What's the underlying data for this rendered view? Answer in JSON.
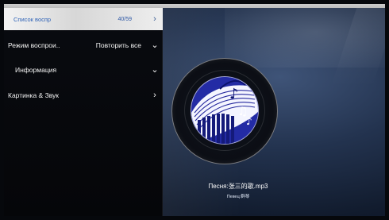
{
  "menu": {
    "playlist": {
      "label": "Список воспр",
      "value": "40/59"
    },
    "playback_mode": {
      "label": "Режим воспрои..",
      "value": "Повторить все"
    },
    "info": {
      "label": "Информация"
    },
    "picture_sound": {
      "label": "Картинка & Звук"
    }
  },
  "icons": {
    "right": "chevron-right-icon",
    "down": "chevron-down-icon"
  },
  "now_playing": {
    "song": "Песня:张三的歌.mp3",
    "artist": "Певец:群琴"
  },
  "colors": {
    "selected_background": "#e6e6e6",
    "selected_text": "#2f63b7",
    "menu_text": "#f4f4f4",
    "screen_background": "#2c3d5c"
  }
}
